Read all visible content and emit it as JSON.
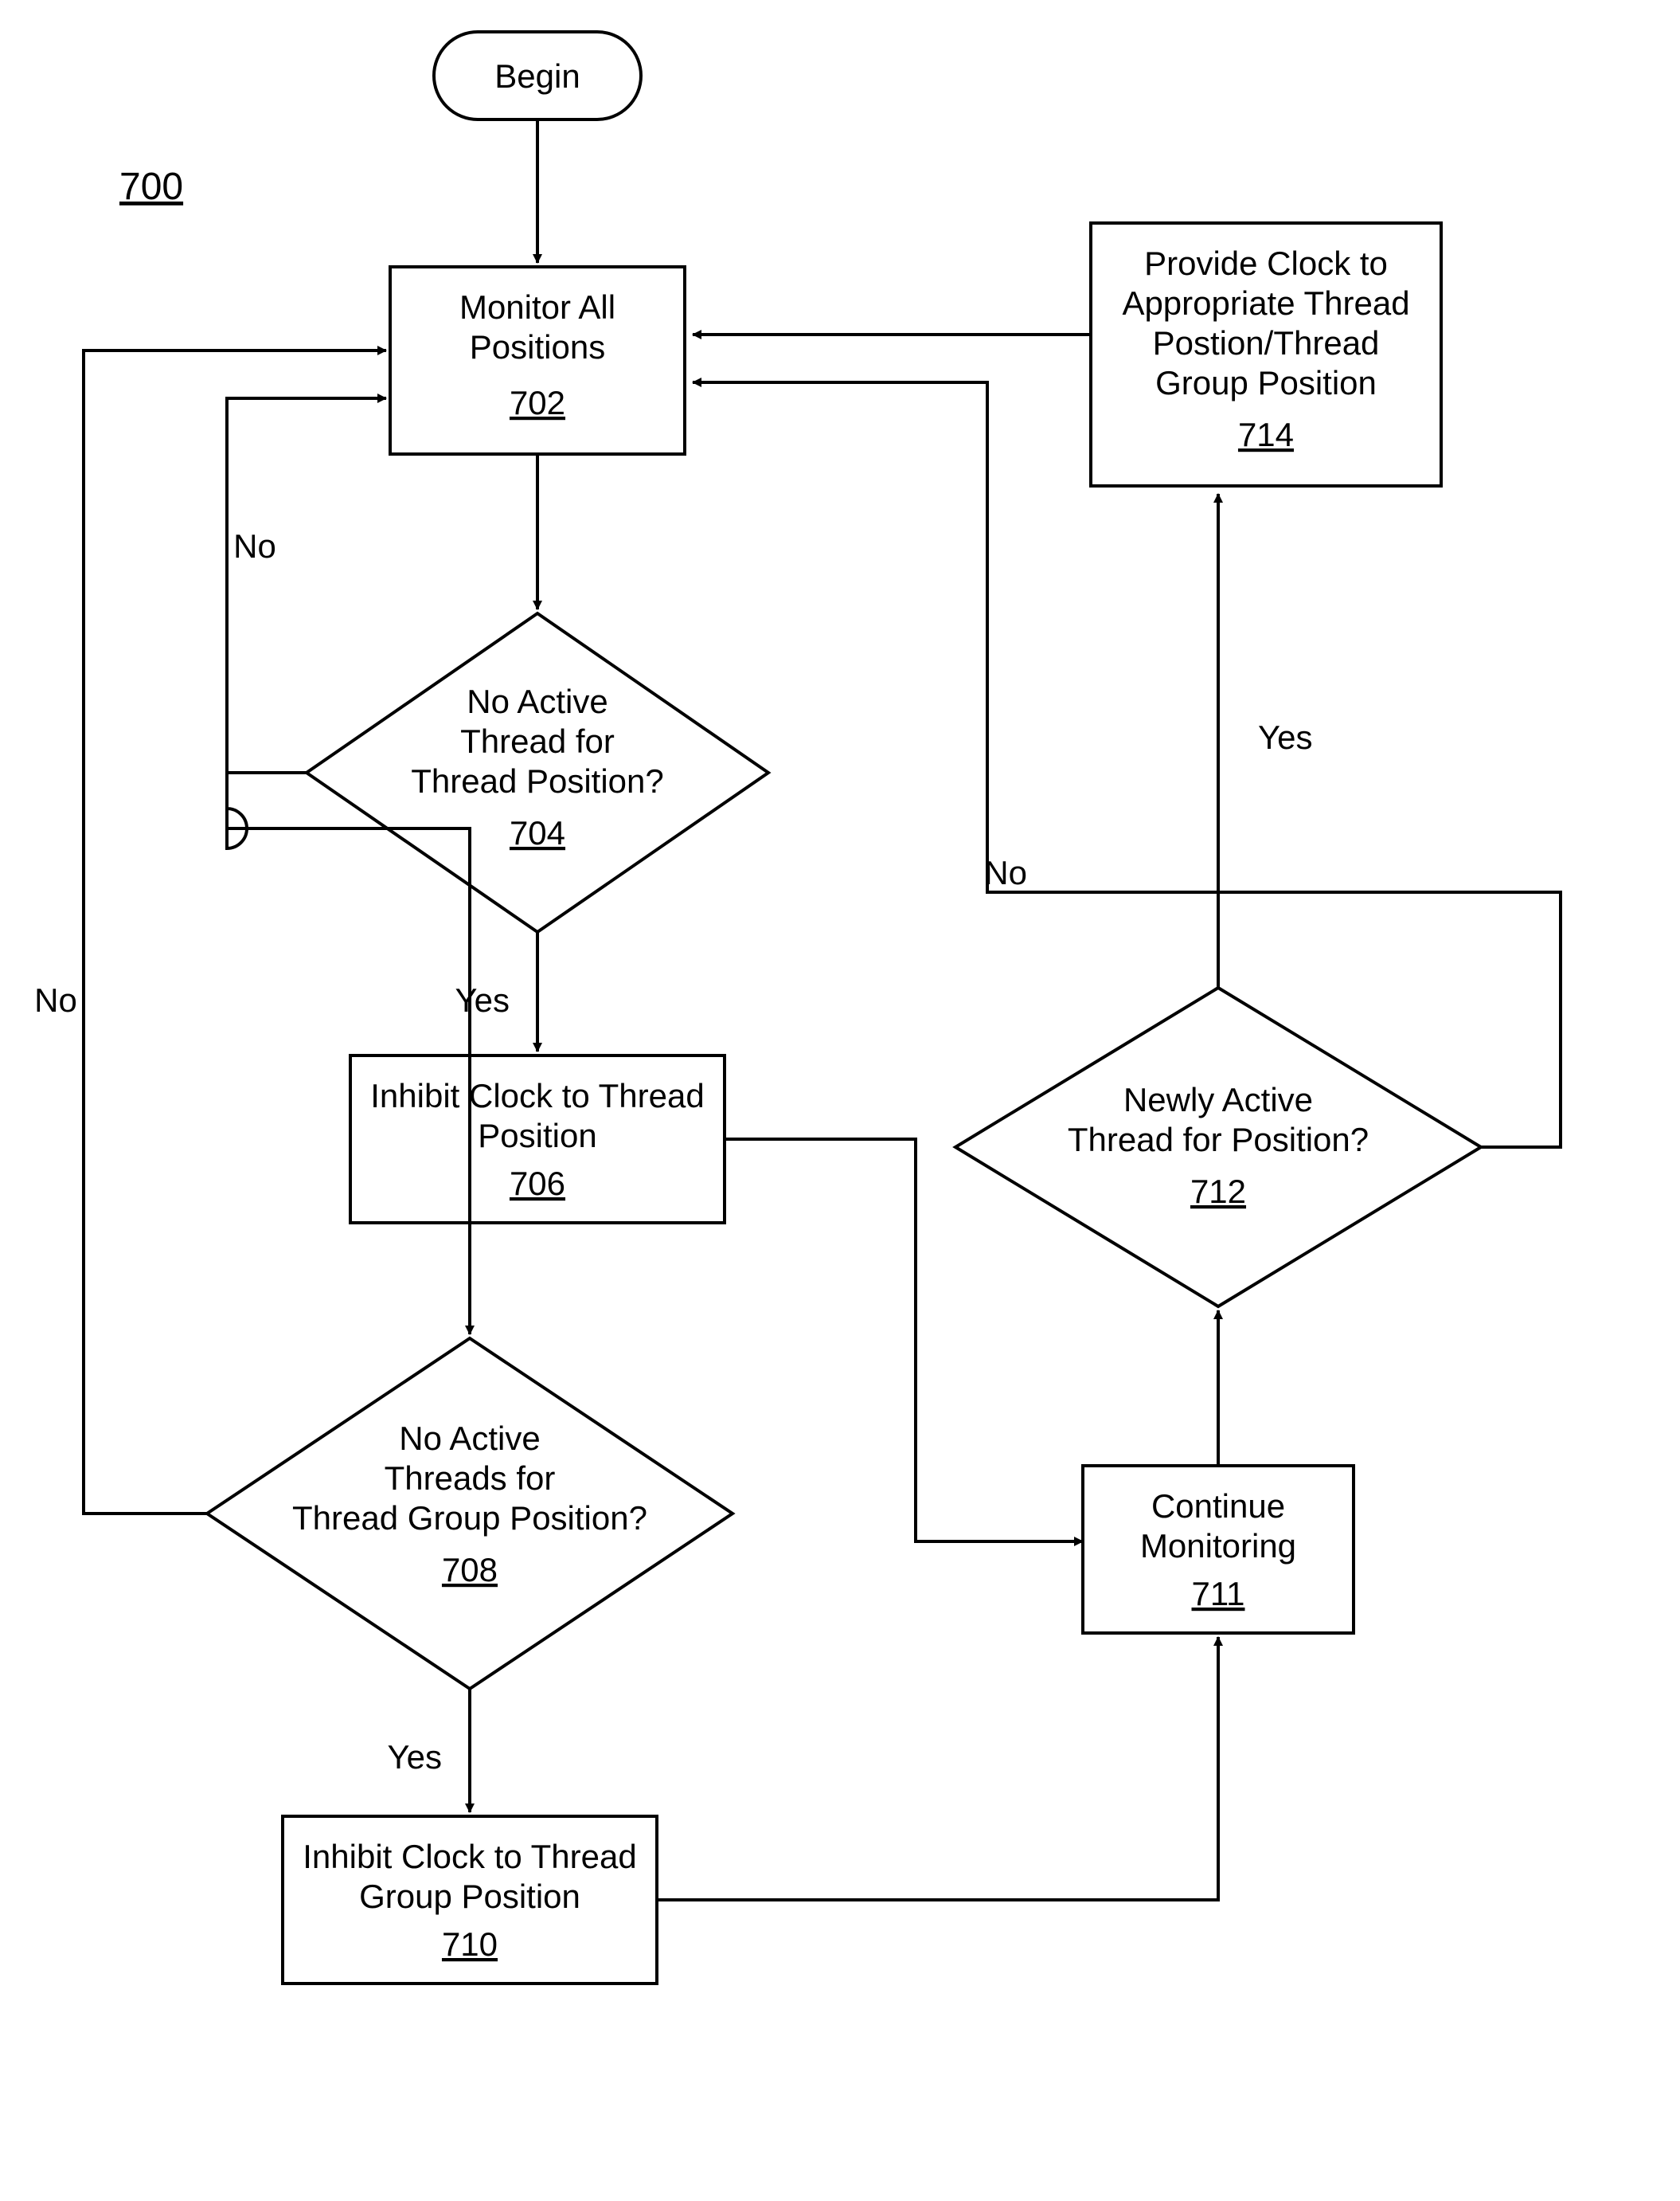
{
  "figure_number": "700",
  "nodes": {
    "begin": {
      "label": "Begin"
    },
    "n702": {
      "line1": "Monitor All",
      "line2": "Positions",
      "ref": "702"
    },
    "n704": {
      "line1": "No Active",
      "line2": "Thread for",
      "line3": "Thread Position?",
      "ref": "704"
    },
    "n706": {
      "line1": "Inhibit Clock to Thread",
      "line2": "Position",
      "ref": "706"
    },
    "n708": {
      "line1": "No Active",
      "line2": "Threads for",
      "line3": "Thread Group Position?",
      "ref": "708"
    },
    "n710": {
      "line1": "Inhibit Clock to Thread",
      "line2": "Group Position",
      "ref": "710"
    },
    "n711": {
      "line1": "Continue",
      "line2": "Monitoring",
      "ref": "711"
    },
    "n712": {
      "line1": "Newly Active",
      "line2": "Thread for Position?",
      "ref": "712"
    },
    "n714": {
      "line1": "Provide Clock to",
      "line2": "Appropriate Thread",
      "line3": "Postion/Thread",
      "line4": "Group Position",
      "ref": "714"
    }
  },
  "edges": {
    "e704_no": "No",
    "e704_yes": "Yes",
    "e708_no": "No",
    "e708_yes": "Yes",
    "e712_no": "No",
    "e712_yes": "Yes"
  }
}
